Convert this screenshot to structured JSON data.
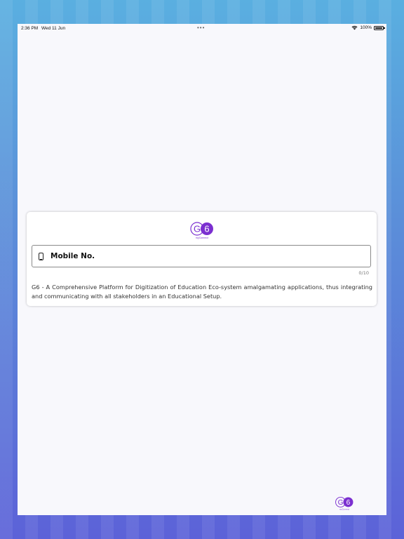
{
  "status_bar": {
    "time": "2:36 PM",
    "date": "Wed 11 Jun",
    "dots": "•••",
    "battery_level": "100%"
  },
  "logo": {
    "text_left": "G",
    "text_right": "6",
    "tagline": "myConnect",
    "accent_color": "#7b2fd0"
  },
  "login": {
    "input_placeholder": "Mobile No.",
    "counter": "0/10",
    "description": "G6 - A Comprehensive Platform for Digitization of Education Eco-system amalgamating applications, thus integrating and communicating with all stakeholders in an Educational Setup."
  },
  "icons": {
    "phone": "phone-icon",
    "wifi": "wifi-icon",
    "battery": "battery-icon"
  }
}
